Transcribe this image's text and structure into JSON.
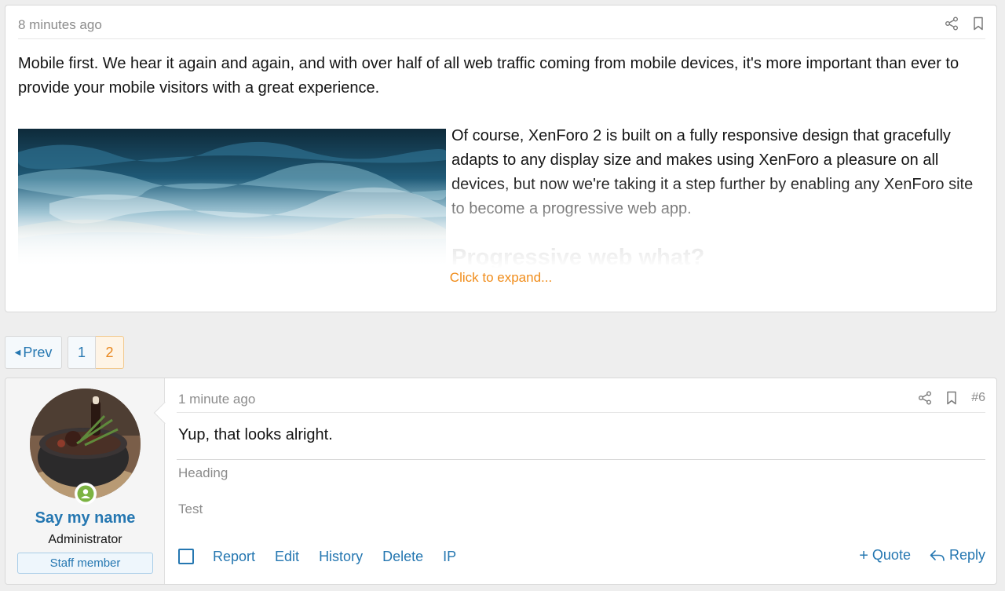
{
  "quote": {
    "time": "8 minutes ago",
    "paragraph1": "Mobile first. We hear it again and again, and with over half of all web traffic coming from mobile devices, it's more important than ever to provide your mobile visitors with a great experience.",
    "paragraph2": "Of course, XenForo 2 is built on a fully responsive design that gracefully adapts to any display size and makes using XenForo a pleasure on all devices, but now we're taking it a step further by enabling any XenForo site to become a progressive web app.",
    "heading": "Progressive web what?",
    "expand_label": "Click to expand...",
    "icons": [
      "share-icon",
      "bookmark-icon"
    ]
  },
  "pagination": {
    "prev_label": "Prev",
    "pages": [
      "1",
      "2"
    ],
    "current": "2"
  },
  "post": {
    "username": "Say my name",
    "user_title": "Administrator",
    "staff_badge": "Staff member",
    "time": "1 minute ago",
    "post_number": "#6",
    "body": "Yup, that looks alright.",
    "heading": "Heading",
    "signature": "Test",
    "actions": {
      "report": "Report",
      "edit": "Edit",
      "history": "History",
      "delete": "Delete",
      "ip": "IP",
      "quote": "Quote",
      "reply": "Reply"
    }
  },
  "colors": {
    "link": "#2577b1",
    "accent": "#f08c1a",
    "online": "#7cb342"
  }
}
